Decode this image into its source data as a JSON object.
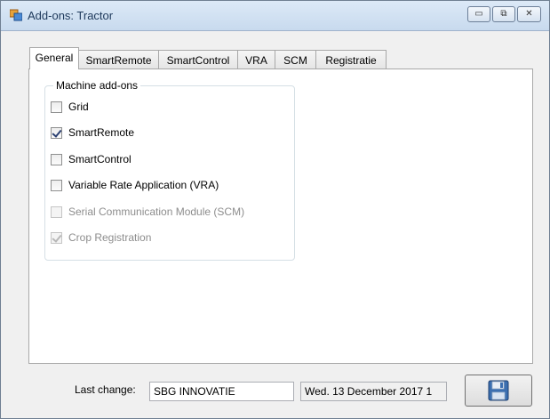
{
  "window": {
    "title": "Add-ons: Tractor",
    "minimize_glyph": "▭",
    "restore_glyph": "⧉",
    "close_glyph": "✕"
  },
  "tabs": [
    {
      "label": "General",
      "active": true
    },
    {
      "label": "SmartRemote",
      "active": false
    },
    {
      "label": "SmartControl",
      "active": false
    },
    {
      "label": "VRA",
      "active": false
    },
    {
      "label": "SCM",
      "active": false
    },
    {
      "label": "Registratie",
      "active": false
    }
  ],
  "group": {
    "label": "Machine add-ons",
    "items": [
      {
        "label": "Grid",
        "checked": false,
        "enabled": true
      },
      {
        "label": "SmartRemote",
        "checked": true,
        "enabled": true
      },
      {
        "label": "SmartControl",
        "checked": false,
        "enabled": true
      },
      {
        "label": "Variable Rate Application (VRA)",
        "checked": false,
        "enabled": true
      },
      {
        "label": "Serial Communication Module (SCM)",
        "checked": false,
        "enabled": false
      },
      {
        "label": "Crop Registration",
        "checked": true,
        "enabled": false
      }
    ]
  },
  "footer": {
    "last_change_label": "Last change:",
    "user_value": "SBG INNOVATIE",
    "date_value": "Wed. 13 December 2017 1"
  },
  "icons": {
    "app": "app-window-icon",
    "save": "floppy-disk-icon"
  },
  "colors": {
    "titlebar": "#dce9f7",
    "check": "#2a3f71",
    "save_icon": "#3c6fb0"
  }
}
